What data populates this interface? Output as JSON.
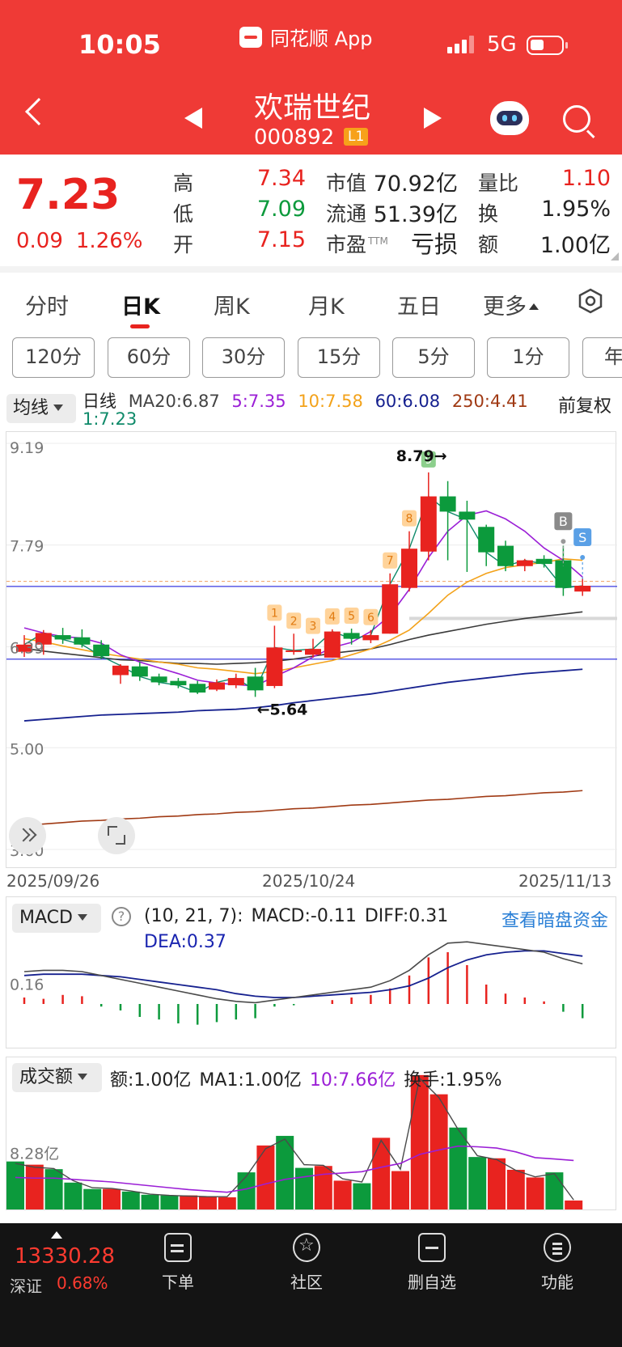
{
  "status_bar": {
    "time": "10:05",
    "app_name": "同花顺 App",
    "network": "5G"
  },
  "header": {
    "stock_name": "欢瑞世纪",
    "stock_code": "000892",
    "level": "L1"
  },
  "quote": {
    "price": "7.23",
    "change": "0.09",
    "change_pct": "1.26%",
    "rows": [
      [
        {
          "label": "高",
          "value": "7.34",
          "color": "red"
        },
        {
          "label": "市值",
          "value": "70.92亿"
        },
        {
          "label": "量比",
          "value": "1.10",
          "color": "red"
        }
      ],
      [
        {
          "label": "低",
          "value": "7.09",
          "color": "green"
        },
        {
          "label": "流通",
          "value": "51.39亿"
        },
        {
          "label": "换",
          "value": "1.95%"
        }
      ],
      [
        {
          "label": "开",
          "value": "7.15",
          "color": "red"
        },
        {
          "label": "市盈",
          "sup": "TTM",
          "value": "亏损"
        },
        {
          "label": "额",
          "value": "1.00亿"
        }
      ]
    ]
  },
  "tabs": [
    "分时",
    "日K",
    "周K",
    "月K",
    "五日",
    "更多"
  ],
  "active_tab": "日K",
  "periods": [
    "120分",
    "60分",
    "30分",
    "15分",
    "5分",
    "1分",
    "年"
  ],
  "ma": {
    "button": "均线",
    "kline_label": "日线",
    "ma20": "MA20:6.87",
    "ma5": "5:7.35",
    "ma10": "10:7.58",
    "ma60": "60:6.08",
    "ma250": "250:4.41",
    "ma1": "1:7.23",
    "adjust": "前复权"
  },
  "colors": {
    "up": "#e8231f",
    "down": "#0c9a3c",
    "ma5": "#9b1fd6",
    "ma10": "#f3a21a",
    "ma20": "#3a3a3a",
    "ma60": "#16218f",
    "ma250": "#a03a14",
    "ma1": "#0f8a6a",
    "header": "#ef3a36"
  },
  "chart_data": [
    {
      "type": "candlestick",
      "y_axis_labels": [
        "9.19",
        "7.79",
        "6.39",
        "5.00",
        "3.60"
      ],
      "ylim": [
        3.6,
        9.19
      ],
      "x_axis_labels": [
        "2025/09/26",
        "2025/10/24",
        "2025/11/13"
      ],
      "annotations": {
        "high": "8.79",
        "low": "5.64",
        "buy_tag": "B",
        "sell_tag": "S",
        "signal_counts": [
          "1",
          "2",
          "3",
          "4",
          "5",
          "6",
          "7",
          "8",
          "9"
        ]
      },
      "candles": [
        {
          "o": 6.32,
          "h": 6.55,
          "l": 6.25,
          "c": 6.42
        },
        {
          "o": 6.42,
          "h": 6.62,
          "l": 6.28,
          "c": 6.58
        },
        {
          "o": 6.55,
          "h": 6.65,
          "l": 6.43,
          "c": 6.49
        },
        {
          "o": 6.52,
          "h": 6.63,
          "l": 6.38,
          "c": 6.42
        },
        {
          "o": 6.42,
          "h": 6.48,
          "l": 6.22,
          "c": 6.26
        },
        {
          "o": 6.0,
          "h": 6.15,
          "l": 5.88,
          "c": 6.13
        },
        {
          "o": 6.12,
          "h": 6.18,
          "l": 5.92,
          "c": 5.98
        },
        {
          "o": 5.98,
          "h": 6.02,
          "l": 5.86,
          "c": 5.9
        },
        {
          "o": 5.92,
          "h": 5.96,
          "l": 5.82,
          "c": 5.86
        },
        {
          "o": 5.88,
          "h": 5.92,
          "l": 5.74,
          "c": 5.76
        },
        {
          "o": 5.8,
          "h": 5.94,
          "l": 5.78,
          "c": 5.9
        },
        {
          "o": 5.86,
          "h": 6.02,
          "l": 5.82,
          "c": 5.96
        },
        {
          "o": 5.98,
          "h": 6.1,
          "l": 5.7,
          "c": 5.79
        },
        {
          "o": 5.85,
          "h": 6.68,
          "l": 5.82,
          "c": 6.38
        },
        {
          "o": 6.32,
          "h": 6.57,
          "l": 6.28,
          "c": 6.34
        },
        {
          "o": 6.28,
          "h": 6.5,
          "l": 6.24,
          "c": 6.36
        },
        {
          "o": 6.24,
          "h": 6.63,
          "l": 6.24,
          "c": 6.6
        },
        {
          "o": 6.58,
          "h": 6.64,
          "l": 6.42,
          "c": 6.5
        },
        {
          "o": 6.48,
          "h": 6.62,
          "l": 6.44,
          "c": 6.55
        },
        {
          "o": 6.57,
          "h": 7.4,
          "l": 6.57,
          "c": 7.25
        },
        {
          "o": 7.2,
          "h": 7.98,
          "l": 7.15,
          "c": 7.74
        },
        {
          "o": 7.7,
          "h": 8.79,
          "l": 7.58,
          "c": 8.46
        },
        {
          "o": 8.46,
          "h": 8.67,
          "l": 7.58,
          "c": 8.25
        },
        {
          "o": 8.25,
          "h": 8.4,
          "l": 7.42,
          "c": 8.14
        },
        {
          "o": 8.04,
          "h": 8.07,
          "l": 7.5,
          "c": 7.69
        },
        {
          "o": 7.78,
          "h": 7.85,
          "l": 7.43,
          "c": 7.5
        },
        {
          "o": 7.5,
          "h": 7.6,
          "l": 7.43,
          "c": 7.58
        },
        {
          "o": 7.6,
          "h": 7.65,
          "l": 7.48,
          "c": 7.53
        },
        {
          "o": 7.58,
          "h": 7.78,
          "l": 7.09,
          "c": 7.2
        },
        {
          "o": 7.15,
          "h": 7.34,
          "l": 7.09,
          "c": 7.23
        }
      ],
      "ma5": [
        6.65,
        6.58,
        6.53,
        6.51,
        6.44,
        6.28,
        6.18,
        6.1,
        6.02,
        5.93,
        5.89,
        5.87,
        5.85,
        5.98,
        6.1,
        6.25,
        6.38,
        6.45,
        6.6,
        6.82,
        7.18,
        7.62,
        7.98,
        8.2,
        8.26,
        8.15,
        7.98,
        7.75,
        7.58,
        7.35
      ],
      "ma10": [
        6.5,
        6.46,
        6.4,
        6.35,
        6.3,
        6.26,
        6.22,
        6.18,
        6.15,
        6.1,
        6.08,
        6.05,
        6.02,
        6.05,
        6.1,
        6.15,
        6.2,
        6.28,
        6.36,
        6.48,
        6.62,
        6.85,
        7.1,
        7.28,
        7.4,
        7.48,
        7.52,
        7.55,
        7.6,
        7.58
      ],
      "ma20": [
        6.37,
        6.33,
        6.3,
        6.27,
        6.24,
        6.21,
        6.2,
        6.18,
        6.16,
        6.16,
        6.15,
        6.16,
        6.17,
        6.19,
        6.22,
        6.26,
        6.3,
        6.33,
        6.36,
        6.42,
        6.49,
        6.55,
        6.6,
        6.65,
        6.7,
        6.74,
        6.78,
        6.81,
        6.84,
        6.87
      ],
      "ma60": [
        5.37,
        5.39,
        5.41,
        5.43,
        5.45,
        5.46,
        5.47,
        5.48,
        5.49,
        5.51,
        5.52,
        5.53,
        5.55,
        5.58,
        5.62,
        5.65,
        5.68,
        5.71,
        5.74,
        5.78,
        5.82,
        5.86,
        5.9,
        5.93,
        5.96,
        5.99,
        6.02,
        6.04,
        6.06,
        6.08
      ],
      "ma250": [
        3.93,
        3.95,
        3.97,
        3.99,
        4.0,
        4.02,
        4.03,
        4.05,
        4.06,
        4.08,
        4.09,
        4.11,
        4.12,
        4.14,
        4.16,
        4.17,
        4.19,
        4.21,
        4.22,
        4.24,
        4.26,
        4.28,
        4.29,
        4.31,
        4.33,
        4.34,
        4.36,
        4.38,
        4.39,
        4.41
      ]
    },
    {
      "type": "bar",
      "indicator": "MACD",
      "params": "(10, 21, 7):",
      "macd": "MACD:-0.11",
      "diff": "DIFF:0.31",
      "dea": "DEA:0.37",
      "y_axis_labels": [
        "0.16"
      ],
      "ylim": [
        -0.3,
        0.7
      ],
      "hist": [
        0.05,
        0.04,
        0.07,
        0.06,
        -0.02,
        -0.05,
        -0.1,
        -0.12,
        -0.15,
        -0.16,
        -0.14,
        -0.12,
        -0.11,
        -0.02,
        -0.01,
        0.0,
        0.03,
        0.05,
        0.07,
        0.12,
        0.22,
        0.36,
        0.4,
        0.3,
        0.15,
        0.08,
        0.05,
        0.02,
        -0.06,
        -0.11
      ],
      "diff_line": [
        0.25,
        0.26,
        0.26,
        0.25,
        0.22,
        0.19,
        0.16,
        0.13,
        0.1,
        0.07,
        0.04,
        0.02,
        0.01,
        0.03,
        0.05,
        0.07,
        0.09,
        0.11,
        0.13,
        0.18,
        0.26,
        0.38,
        0.47,
        0.48,
        0.46,
        0.44,
        0.42,
        0.4,
        0.35,
        0.31
      ],
      "dea_line": [
        0.22,
        0.23,
        0.23,
        0.23,
        0.22,
        0.21,
        0.19,
        0.17,
        0.15,
        0.13,
        0.11,
        0.08,
        0.06,
        0.05,
        0.05,
        0.06,
        0.07,
        0.08,
        0.09,
        0.11,
        0.14,
        0.2,
        0.28,
        0.34,
        0.38,
        0.4,
        0.41,
        0.41,
        0.39,
        0.37
      ],
      "dark_pool_link": "查看暗盘资金"
    },
    {
      "type": "bar",
      "indicator": "成交额",
      "amount": "额:1.00亿",
      "ma1": "MA1:1.00亿",
      "ma10": "10:7.66亿",
      "turnover": "换手:1.95%",
      "y_axis_labels": [
        "8.28亿"
      ],
      "ylim": [
        0,
        22
      ],
      "values": [
        7.5,
        7.0,
        6.3,
        4.2,
        3.2,
        3.2,
        2.8,
        2.3,
        2.2,
        2.2,
        2.0,
        1.9,
        5.8,
        10.0,
        11.5,
        6.5,
        6.8,
        4.5,
        4.1,
        11.2,
        6.0,
        21.0,
        18.0,
        12.8,
        8.2,
        8.0,
        6.2,
        5.0,
        5.8,
        1.4
      ],
      "colors": [
        "down",
        "up",
        "down",
        "down",
        "down",
        "up",
        "down",
        "down",
        "down",
        "up",
        "up",
        "up",
        "down",
        "up",
        "down",
        "down",
        "up",
        "up",
        "down",
        "up",
        "up",
        "up",
        "up",
        "down",
        "down",
        "up",
        "up",
        "up",
        "down",
        "up"
      ],
      "ma_line": [
        5.0,
        4.9,
        4.9,
        4.7,
        4.5,
        4.3,
        4.0,
        3.7,
        3.4,
        3.1,
        2.9,
        2.7,
        3.2,
        4.0,
        4.7,
        5.1,
        5.5,
        5.7,
        5.9,
        6.6,
        7.2,
        8.6,
        9.3,
        9.9,
        9.8,
        9.6,
        9.0,
        8.1,
        7.9,
        7.66
      ],
      "ma_raw": [
        7.2,
        6.6,
        6.4,
        4.5,
        3.4,
        3.3,
        2.9,
        2.4,
        2.2,
        2.1,
        2.0,
        2.0,
        5.2,
        9.5,
        11.0,
        7.0,
        6.9,
        4.8,
        4.3,
        10.8,
        6.3,
        20.5,
        17.5,
        12.5,
        8.4,
        7.8,
        6.1,
        5.1,
        5.6,
        1.5
      ]
    }
  ],
  "nav": {
    "index_value": "13330.28",
    "index_name": "深证",
    "index_change": "0.68%",
    "items": [
      "下单",
      "社区",
      "删自选",
      "功能"
    ]
  }
}
